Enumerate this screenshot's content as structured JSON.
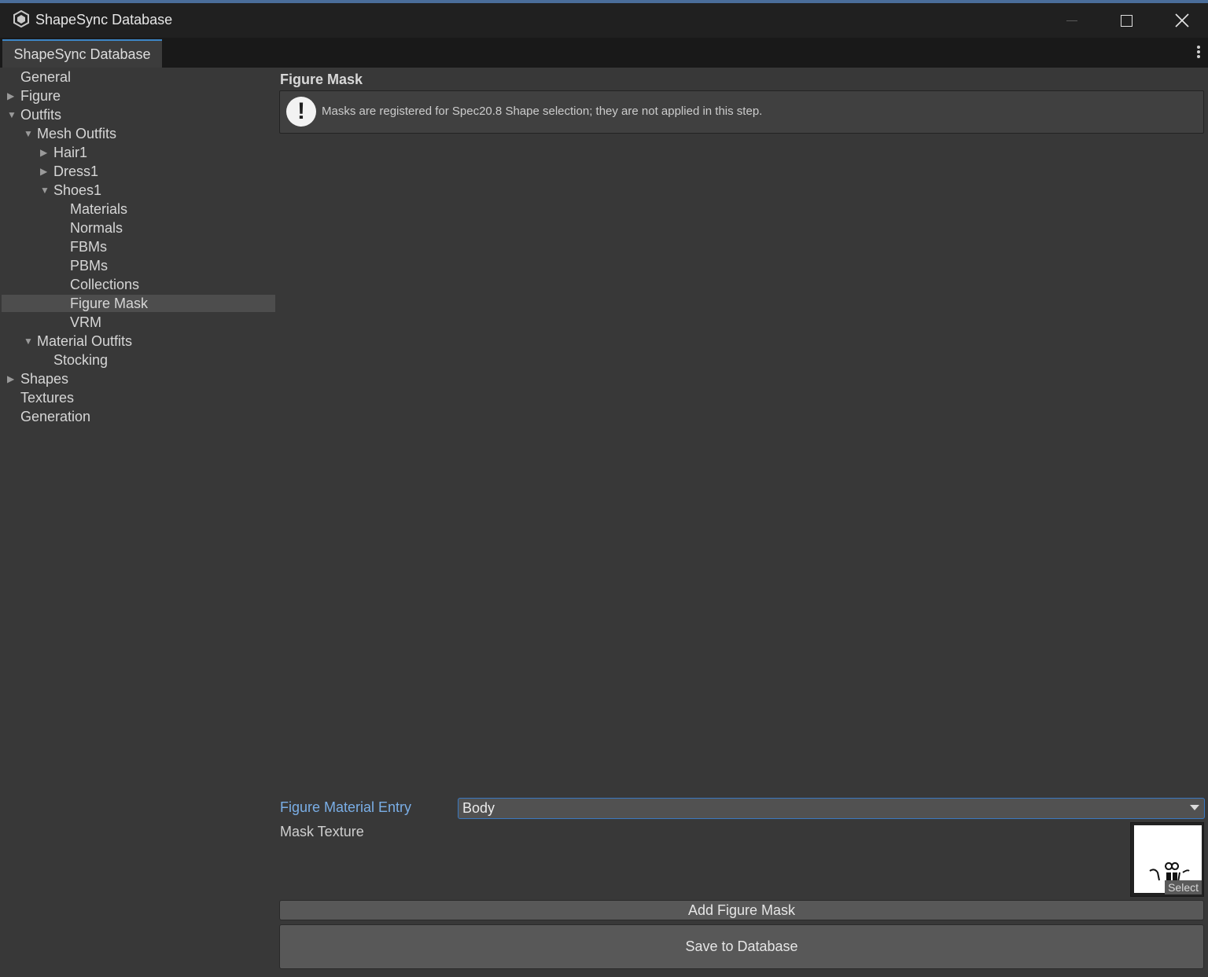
{
  "window": {
    "title": "ShapeSync Database"
  },
  "tab": {
    "label": "ShapeSync Database"
  },
  "tree": [
    {
      "label": "General"
    },
    {
      "label": "Figure"
    },
    {
      "label": "Outfits"
    },
    {
      "label": "Mesh Outfits"
    },
    {
      "label": "Hair1"
    },
    {
      "label": "Dress1"
    },
    {
      "label": "Shoes1"
    },
    {
      "label": "Materials"
    },
    {
      "label": "Normals"
    },
    {
      "label": "FBMs"
    },
    {
      "label": "PBMs"
    },
    {
      "label": "Collections"
    },
    {
      "label": "Figure Mask"
    },
    {
      "label": "VRM"
    },
    {
      "label": "Material Outfits"
    },
    {
      "label": "Stocking"
    },
    {
      "label": "Shapes"
    },
    {
      "label": "Textures"
    },
    {
      "label": "Generation"
    }
  ],
  "main": {
    "section_title": "Figure Mask",
    "help_text": "Masks are registered for Spec20.8 Shape selection; they are not applied in this step.",
    "figure_material_label": "Figure Material Entry",
    "figure_material_value": "Body",
    "mask_texture_label": "Mask Texture",
    "select_label": "Select",
    "add_button": "Add Figure Mask",
    "save_button": "Save to Database"
  },
  "colors": {
    "accent": "#3d86c6",
    "label_focus": "#7aaee6",
    "background": "#383838"
  }
}
